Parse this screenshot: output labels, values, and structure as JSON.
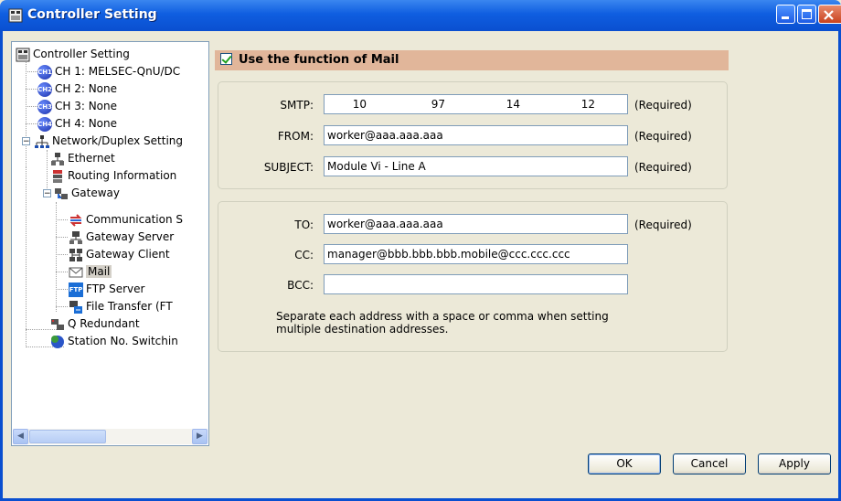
{
  "window": {
    "title": "Controller Setting"
  },
  "tree": {
    "items": [
      {
        "label": "Controller Setting",
        "icon": "controller-icon"
      },
      {
        "label": "CH 1: MELSEC-QnU/DC",
        "icon": "ch1-icon"
      },
      {
        "label": "CH 2: None",
        "icon": "ch2-icon"
      },
      {
        "label": "CH 3: None",
        "icon": "ch3-icon"
      },
      {
        "label": "CH 4: None",
        "icon": "ch4-icon"
      },
      {
        "label": "Network/Duplex Setting",
        "icon": "network-icon"
      },
      {
        "label": "Ethernet",
        "icon": "ethernet-icon"
      },
      {
        "label": "Routing Information",
        "icon": "routing-icon"
      },
      {
        "label": "Gateway",
        "icon": "gateway-icon"
      },
      {
        "label": "Communication S",
        "icon": "communication-icon"
      },
      {
        "label": "Gateway Server",
        "icon": "gateway-server-icon"
      },
      {
        "label": "Gateway Client",
        "icon": "gateway-client-icon"
      },
      {
        "label": "Mail",
        "icon": "mail-icon"
      },
      {
        "label": "FTP Server",
        "icon": "ftp-icon"
      },
      {
        "label": "File Transfer (FT",
        "icon": "file-transfer-icon"
      },
      {
        "label": "Q Redundant",
        "icon": "redundant-icon"
      },
      {
        "label": "Station No. Switchin",
        "icon": "station-icon"
      }
    ],
    "ch_badges": [
      "CH1",
      "CH2",
      "CH3",
      "CH4"
    ],
    "ftp_badge": "FTP"
  },
  "mail": {
    "use_label": "Use the function of Mail",
    "use_checked": true,
    "smtp_label": "SMTP:",
    "smtp_ip": [
      "10",
      "97",
      "14",
      "12"
    ],
    "from_label": "FROM:",
    "from_value": "worker@aaa.aaa.aaa",
    "subject_label": "SUBJECT:",
    "subject_value": "Module Vi - Line A",
    "to_label": "TO:",
    "to_value": "worker@aaa.aaa.aaa",
    "cc_label": "CC:",
    "cc_value": "manager@bbb.bbb.bbb.mobile@ccc.ccc.ccc",
    "bcc_label": "BCC:",
    "bcc_value": "",
    "required": "(Required)",
    "note_line1": "Separate each address with a space or comma when setting",
    "note_line2": "multiple destination addresses."
  },
  "buttons": {
    "ok": "OK",
    "cancel": "Cancel",
    "apply": "Apply"
  }
}
